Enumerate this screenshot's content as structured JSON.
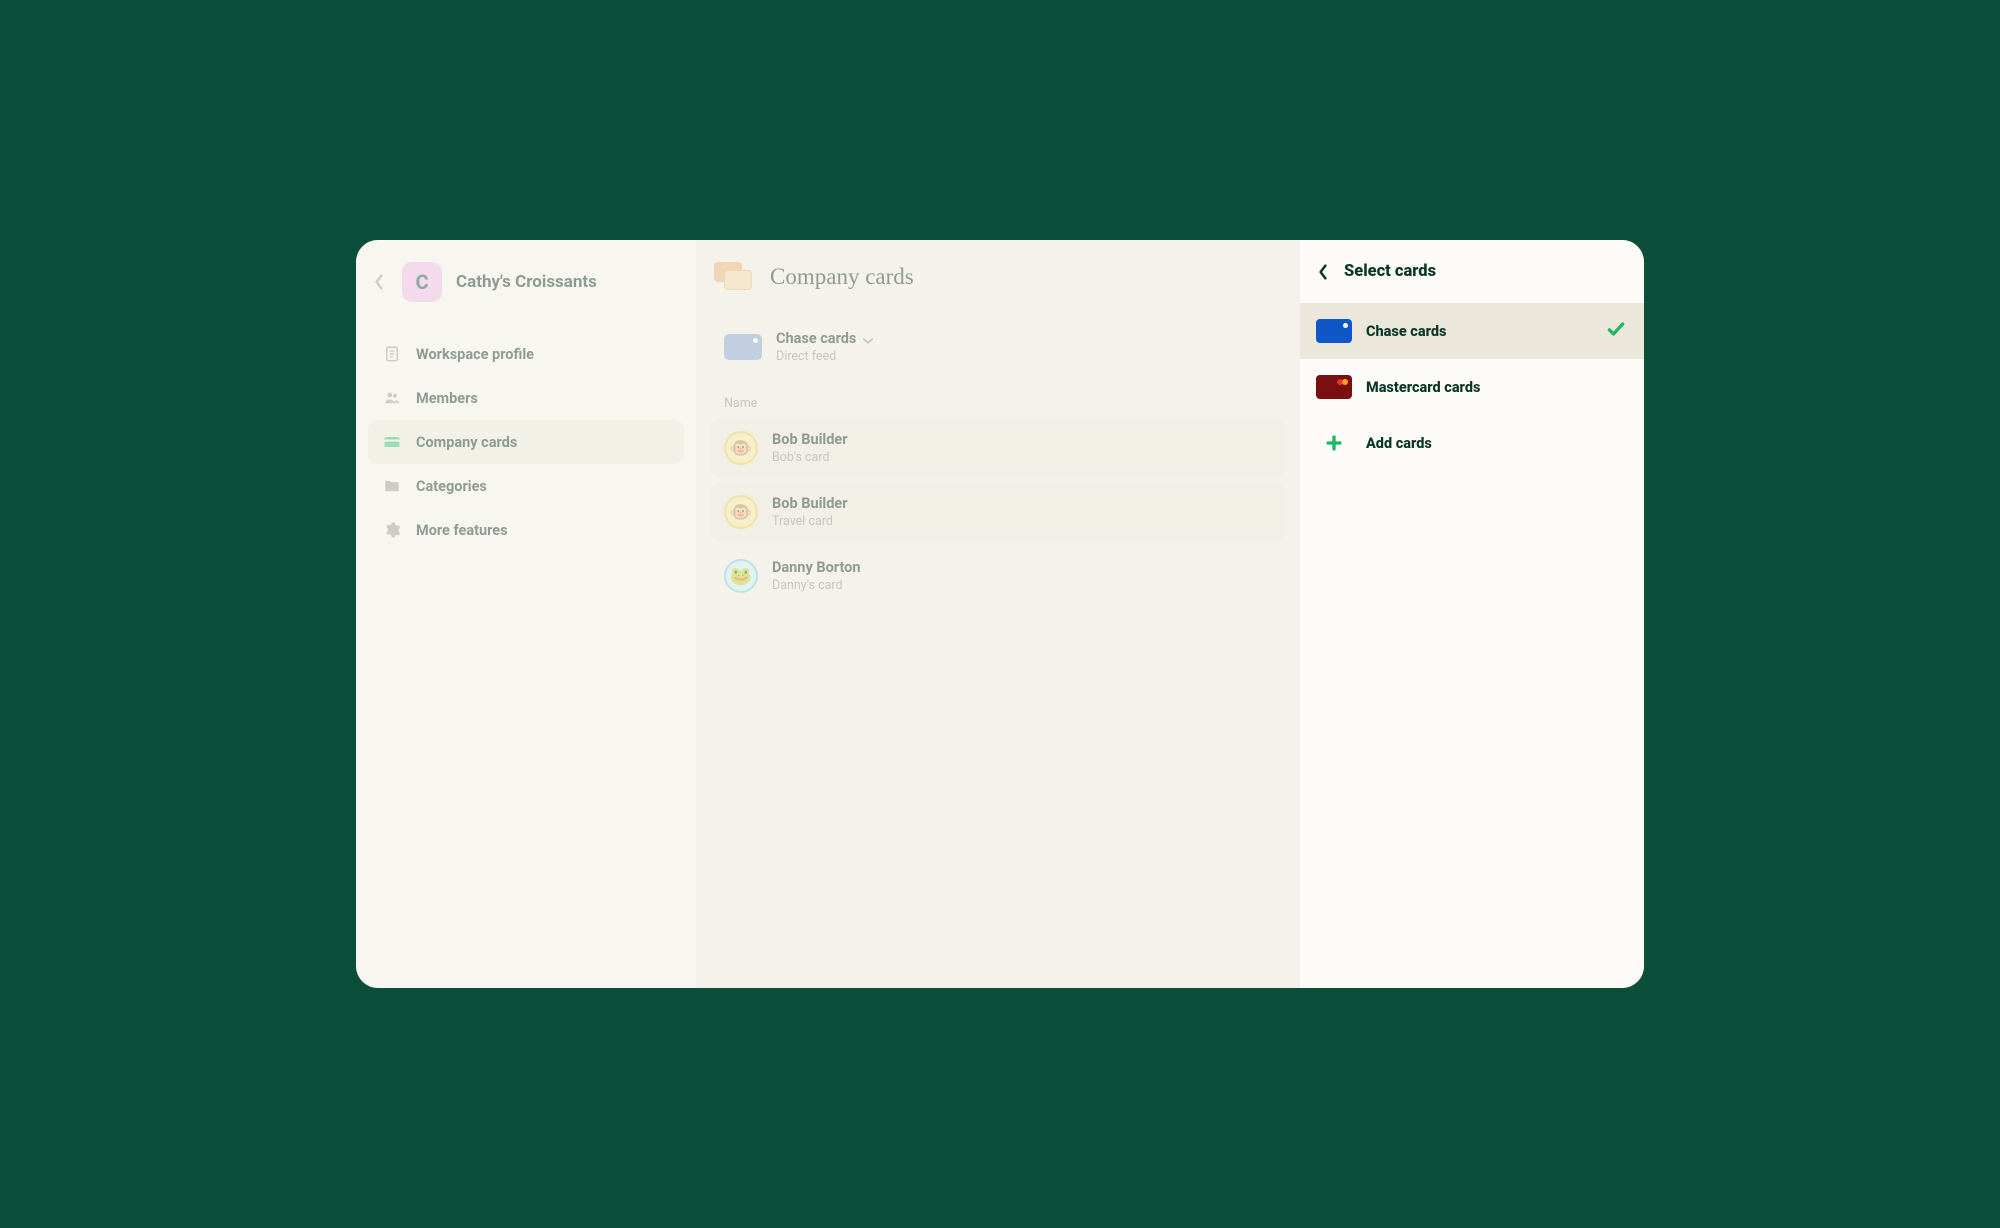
{
  "workspace": {
    "avatar_letter": "C",
    "title": "Cathy's Croissants"
  },
  "sidebar": {
    "items": [
      {
        "label": "Workspace profile",
        "icon": "document-icon",
        "active": false
      },
      {
        "label": "Members",
        "icon": "members-icon",
        "active": false
      },
      {
        "label": "Company cards",
        "icon": "card-icon",
        "active": true
      },
      {
        "label": "Categories",
        "icon": "folder-icon",
        "active": false
      },
      {
        "label": "More features",
        "icon": "gear-icon",
        "active": false
      }
    ]
  },
  "main": {
    "title": "Company cards",
    "feed": {
      "name": "Chase cards",
      "sub": "Direct feed"
    },
    "column_header": "Name",
    "rows": [
      {
        "name": "Bob Builder",
        "card": "Bob's card",
        "avatar": "gold"
      },
      {
        "name": "Bob Builder",
        "card": "Travel card",
        "avatar": "gold"
      },
      {
        "name": "Danny Borton",
        "card": "Danny's card",
        "avatar": "teal"
      }
    ]
  },
  "right": {
    "title": "Select cards",
    "options": [
      {
        "label": "Chase cards",
        "variant": "blue",
        "selected": true
      },
      {
        "label": "Mastercard cards",
        "variant": "red",
        "selected": false
      }
    ],
    "add_label": "Add cards"
  }
}
